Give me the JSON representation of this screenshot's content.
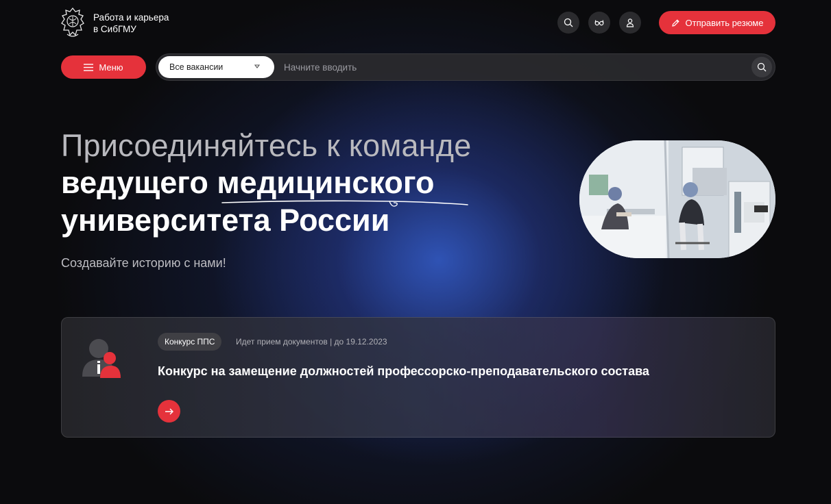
{
  "colors": {
    "accent": "#e5323b",
    "background": "#0b0b0d",
    "glow": "#345cc8"
  },
  "header": {
    "logo_icon": "university-emblem-icon",
    "logo_line1": "Работа и карьера",
    "logo_line2": "в СибГМУ",
    "icons": [
      "search-icon",
      "glasses-icon",
      "user-icon"
    ],
    "resume_button": "Отправить резюме",
    "resume_icon": "pencil-icon"
  },
  "search": {
    "menu_label": "Меню",
    "menu_icon": "hamburger-icon",
    "vacancy_filter": "Все вакансии",
    "placeholder": "Начните вводить"
  },
  "hero": {
    "line1": "Присоединяйтесь к команде",
    "line2": "ведущего медицинского",
    "line3": "университета России",
    "subtitle": "Создавайте историю с нами!"
  },
  "card": {
    "icon": "person-badge-icon",
    "tag": "Конкурс ППС",
    "status": "Идет прием документов | до 19.12.2023",
    "title": "Конкурс на замещение должностей профессорско-преподавательского состава",
    "arrow_icon": "arrow-right-icon"
  }
}
